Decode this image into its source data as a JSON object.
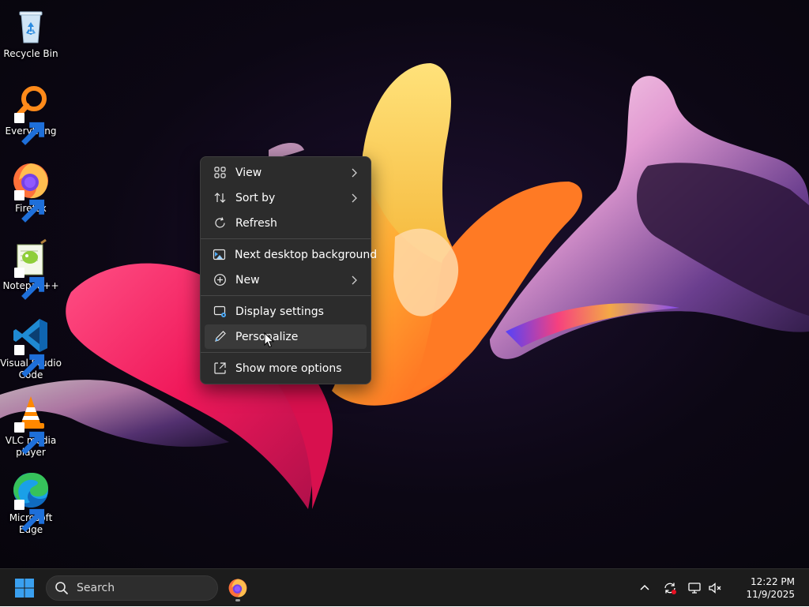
{
  "desktop": {
    "icons": [
      {
        "label": "Recycle Bin",
        "icon": "recycle-bin-icon"
      },
      {
        "label": "Everything",
        "icon": "everything-search-icon"
      },
      {
        "label": "Firefox",
        "icon": "firefox-icon"
      },
      {
        "label": "Notepad++",
        "icon": "notepad-plus-plus-icon"
      },
      {
        "label": "Visual Studio Code",
        "icon": "vscode-icon"
      },
      {
        "label": "VLC media player",
        "icon": "vlc-icon"
      },
      {
        "label": "Microsoft Edge",
        "icon": "edge-icon"
      }
    ]
  },
  "context_menu": {
    "items": [
      {
        "label": "View",
        "icon": "grid-icon",
        "submenu": true
      },
      {
        "label": "Sort by",
        "icon": "sort-arrows-icon",
        "submenu": true
      },
      {
        "label": "Refresh",
        "icon": "refresh-icon",
        "submenu": false
      },
      {
        "label": "Next desktop background",
        "icon": "next-background-icon",
        "submenu": false
      },
      {
        "label": "New",
        "icon": "plus-circle-icon",
        "submenu": true
      },
      {
        "label": "Display settings",
        "icon": "display-settings-icon",
        "submenu": false
      },
      {
        "label": "Personalize",
        "icon": "pen-icon",
        "submenu": false,
        "hovered": true
      },
      {
        "label": "Show more options",
        "icon": "expand-icon",
        "submenu": false
      }
    ]
  },
  "taskbar": {
    "start_icon": "windows-logo-icon",
    "search": {
      "placeholder": "Search",
      "value": ""
    },
    "pinned": [
      {
        "name": "Firefox",
        "icon": "firefox-icon",
        "running": true
      }
    ],
    "tray": {
      "icons": [
        "chevron-up-icon",
        "sync-alert-icon",
        "network-icon",
        "volume-muted-icon"
      ]
    },
    "clock": {
      "time": "12:22 PM",
      "date": "11/9/2025"
    }
  },
  "colors": {
    "menu_background": "#2c2c2c",
    "menu_hover": "#3a3a3a",
    "taskbar_background": "#1c1c1c",
    "windows_blue": "#3aa0f0"
  }
}
